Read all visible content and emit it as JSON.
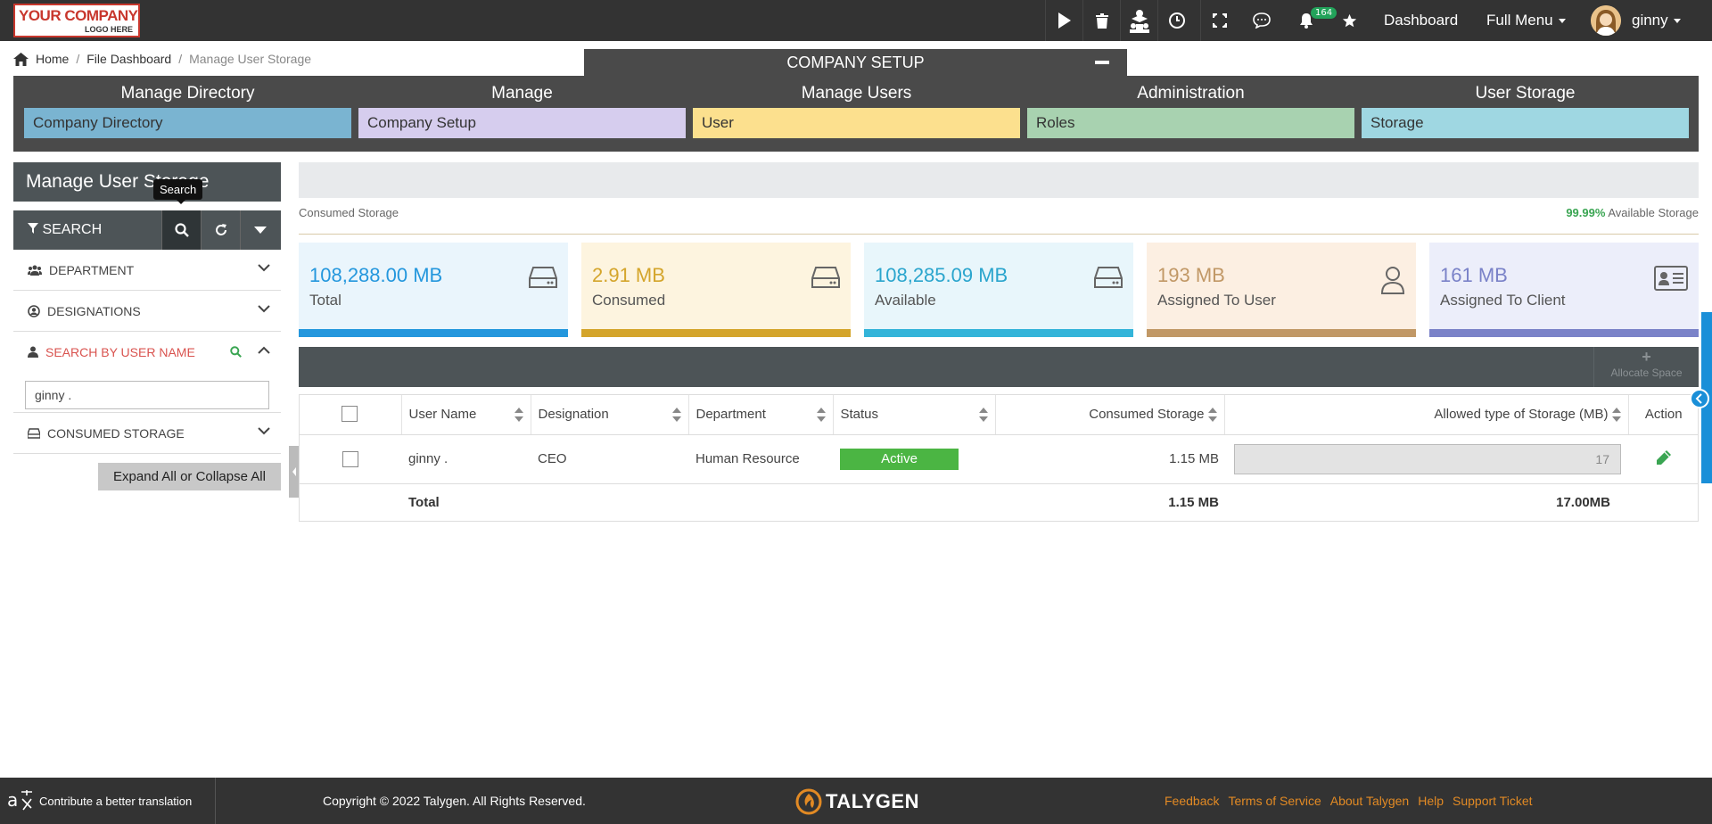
{
  "header": {
    "logo_line1": "YOUR COMPANY",
    "logo_line2": "LOGO HERE",
    "notification_count": "164",
    "dashboard_label": "Dashboard",
    "full_menu_label": "Full Menu",
    "username": "ginny"
  },
  "breadcrumb": {
    "home": "Home",
    "file_dashboard": "File Dashboard",
    "current": "Manage User Storage"
  },
  "company_setup": {
    "title": "COMPANY SETUP",
    "columns": [
      {
        "heading": "Manage Directory",
        "item": "Company Directory",
        "color": "#7ab4d1"
      },
      {
        "heading": "Manage",
        "item": "Company Setup",
        "color": "#d6cdee"
      },
      {
        "heading": "Manage Users",
        "item": "User",
        "color": "#fce08e"
      },
      {
        "heading": "Administration",
        "item": "Roles",
        "color": "#a8d2b0"
      },
      {
        "heading": "User Storage",
        "item": "Storage",
        "color": "#9fd7e2"
      }
    ]
  },
  "left_panel": {
    "title": "Manage User Storage",
    "tooltip": "Search",
    "search_label": "SEARCH",
    "department": "DEPARTMENT",
    "designations": "DESIGNATIONS",
    "search_by_user": "SEARCH BY USER NAME",
    "username_value": "ginny .",
    "consumed_storage": "CONSUMED STORAGE",
    "expand_all": "Expand All or Collapse All"
  },
  "storage_bar": {
    "consumed_label": "Consumed Storage",
    "available_pct": "99.99%",
    "available_label": "Available Storage"
  },
  "cards": [
    {
      "value": "108,288.00 MB",
      "label": "Total",
      "bg": "#eaf5fc",
      "fg": "#2497dd",
      "bar": "#2497dd",
      "icon": "drive-icon"
    },
    {
      "value": "2.91 MB",
      "label": "Consumed",
      "bg": "#fdf4df",
      "fg": "#d4a52b",
      "bar": "#d4a52b",
      "icon": "drive-icon"
    },
    {
      "value": "108,285.09 MB",
      "label": "Available",
      "bg": "#e8f6fb",
      "fg": "#2aa5cd",
      "bar": "#33b4d9",
      "icon": "drive-icon"
    },
    {
      "value": "193 MB",
      "label": "Assigned To User",
      "bg": "#fcefe2",
      "fg": "#c19866",
      "bar": "#c19866",
      "icon": "user-icon"
    },
    {
      "value": "161 MB",
      "label": "Assigned To Client",
      "bg": "#eceefa",
      "fg": "#7a82c8",
      "bar": "#7a82c8",
      "icon": "id-card-icon"
    }
  ],
  "table": {
    "allocate_label": "Allocate Space",
    "columns": [
      "User Name",
      "Designation",
      "Department",
      "Status",
      "Consumed Storage",
      "Allowed type of Storage (MB)",
      "Action"
    ],
    "rows": [
      {
        "user": "ginny .",
        "designation": "CEO",
        "department": "Human Resource",
        "status": "Active",
        "consumed": "1.15 MB",
        "allowed": "17"
      }
    ],
    "total_label": "Total",
    "total_consumed": "1.15 MB",
    "total_allowed": "17.00MB"
  },
  "footer": {
    "translate": "Contribute a better translation",
    "copyright": "Copyright © 2022 Talygen. All Rights Reserved.",
    "brand": "TALYGEN",
    "links": [
      "Feedback",
      "Terms of Service",
      "About Talygen",
      "Help",
      "Support Ticket"
    ]
  }
}
